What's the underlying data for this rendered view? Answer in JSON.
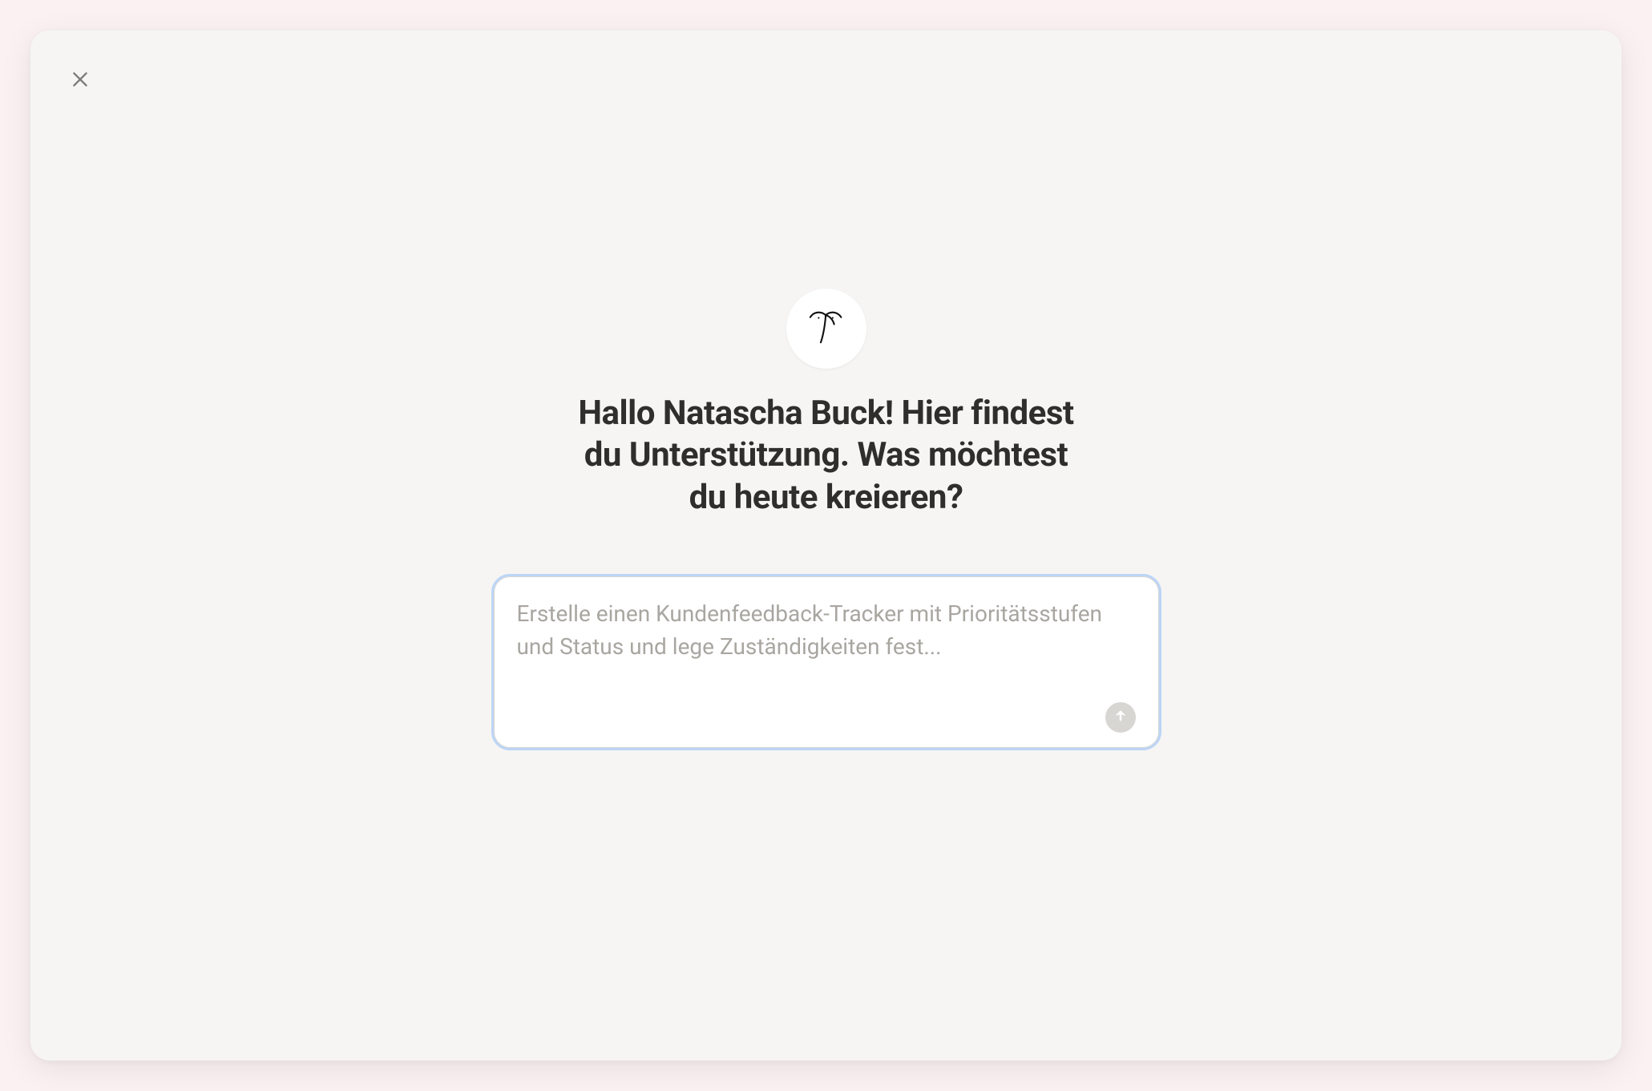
{
  "modal": {
    "close_label": "Close"
  },
  "greeting": {
    "text": "Hallo Natascha Buck! Hier findest du Unterstützung. Was möchtest du heute kreieren?"
  },
  "prompt": {
    "value": "",
    "placeholder": "Erstelle einen Kundenfeedback-Tracker mit Prioritätsstufen und Status und lege Zuständigkeiten fest...",
    "send_label": "Send"
  },
  "logo": {
    "name": "palm-sketch-logo"
  }
}
